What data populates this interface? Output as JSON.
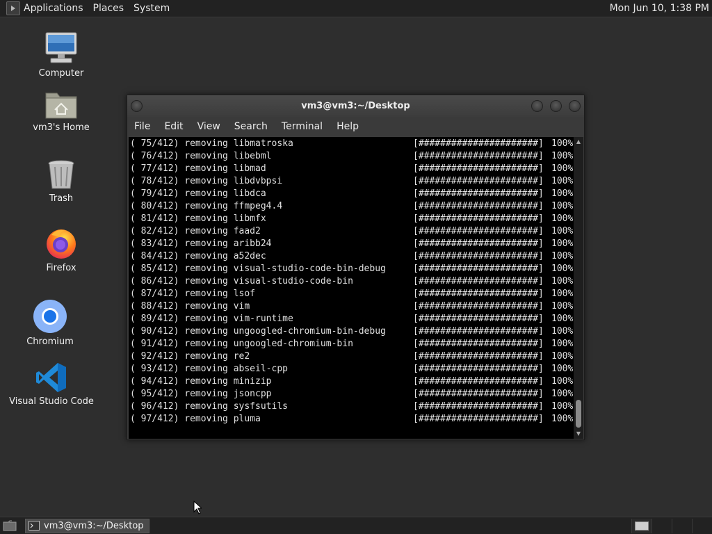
{
  "top_panel": {
    "menus": [
      "Applications",
      "Places",
      "System"
    ],
    "clock": "Mon Jun 10,  1:38 PM"
  },
  "desktop": {
    "icons": [
      {
        "label": "Computer",
        "icon": "computer-icon"
      },
      {
        "label": "vm3's Home",
        "icon": "home-folder-icon"
      },
      {
        "label": "Trash",
        "icon": "trash-icon"
      },
      {
        "label": "Firefox",
        "icon": "firefox-icon"
      },
      {
        "label": "Chromium",
        "icon": "chromium-icon"
      },
      {
        "label": "Visual Studio Code",
        "icon": "vscode-icon"
      }
    ]
  },
  "terminal": {
    "title": "vm3@vm3:~/Desktop",
    "menu": [
      "File",
      "Edit",
      "View",
      "Search",
      "Terminal",
      "Help"
    ],
    "lines": [
      {
        "left": "( 75/412) removing libmatroska",
        "bar": "[######################]",
        "pct": "100%"
      },
      {
        "left": "( 76/412) removing libebml",
        "bar": "[######################]",
        "pct": "100%"
      },
      {
        "left": "( 77/412) removing libmad",
        "bar": "[######################]",
        "pct": "100%"
      },
      {
        "left": "( 78/412) removing libdvbpsi",
        "bar": "[######################]",
        "pct": "100%"
      },
      {
        "left": "( 79/412) removing libdca",
        "bar": "[######################]",
        "pct": "100%"
      },
      {
        "left": "( 80/412) removing ffmpeg4.4",
        "bar": "[######################]",
        "pct": "100%"
      },
      {
        "left": "( 81/412) removing libmfx",
        "bar": "[######################]",
        "pct": "100%"
      },
      {
        "left": "( 82/412) removing faad2",
        "bar": "[######################]",
        "pct": "100%"
      },
      {
        "left": "( 83/412) removing aribb24",
        "bar": "[######################]",
        "pct": "100%"
      },
      {
        "left": "( 84/412) removing a52dec",
        "bar": "[######################]",
        "pct": "100%"
      },
      {
        "left": "( 85/412) removing visual-studio-code-bin-debug",
        "bar": "[######################]",
        "pct": "100%"
      },
      {
        "left": "( 86/412) removing visual-studio-code-bin",
        "bar": "[######################]",
        "pct": "100%"
      },
      {
        "left": "( 87/412) removing lsof",
        "bar": "[######################]",
        "pct": "100%"
      },
      {
        "left": "( 88/412) removing vim",
        "bar": "[######################]",
        "pct": "100%"
      },
      {
        "left": "( 89/412) removing vim-runtime",
        "bar": "[######################]",
        "pct": "100%"
      },
      {
        "left": "( 90/412) removing ungoogled-chromium-bin-debug",
        "bar": "[######################]",
        "pct": "100%"
      },
      {
        "left": "( 91/412) removing ungoogled-chromium-bin",
        "bar": "[######################]",
        "pct": "100%"
      },
      {
        "left": "( 92/412) removing re2",
        "bar": "[######################]",
        "pct": "100%"
      },
      {
        "left": "( 93/412) removing abseil-cpp",
        "bar": "[######################]",
        "pct": "100%"
      },
      {
        "left": "( 94/412) removing minizip",
        "bar": "[######################]",
        "pct": "100%"
      },
      {
        "left": "( 95/412) removing jsoncpp",
        "bar": "[######################]",
        "pct": "100%"
      },
      {
        "left": "( 96/412) removing sysfsutils",
        "bar": "[######################]",
        "pct": "100%"
      },
      {
        "left": "( 97/412) removing pluma",
        "bar": "[######################]",
        "pct": "100%"
      }
    ]
  },
  "taskbar": {
    "tasks": [
      {
        "label": "vm3@vm3:~/Desktop",
        "icon": "terminal-icon"
      }
    ]
  },
  "colors": {
    "desktop_bg": "#2e2e2e",
    "panel_bg": "#222222",
    "terminal_bg": "#000000",
    "terminal_fg": "#e0e0e0"
  }
}
